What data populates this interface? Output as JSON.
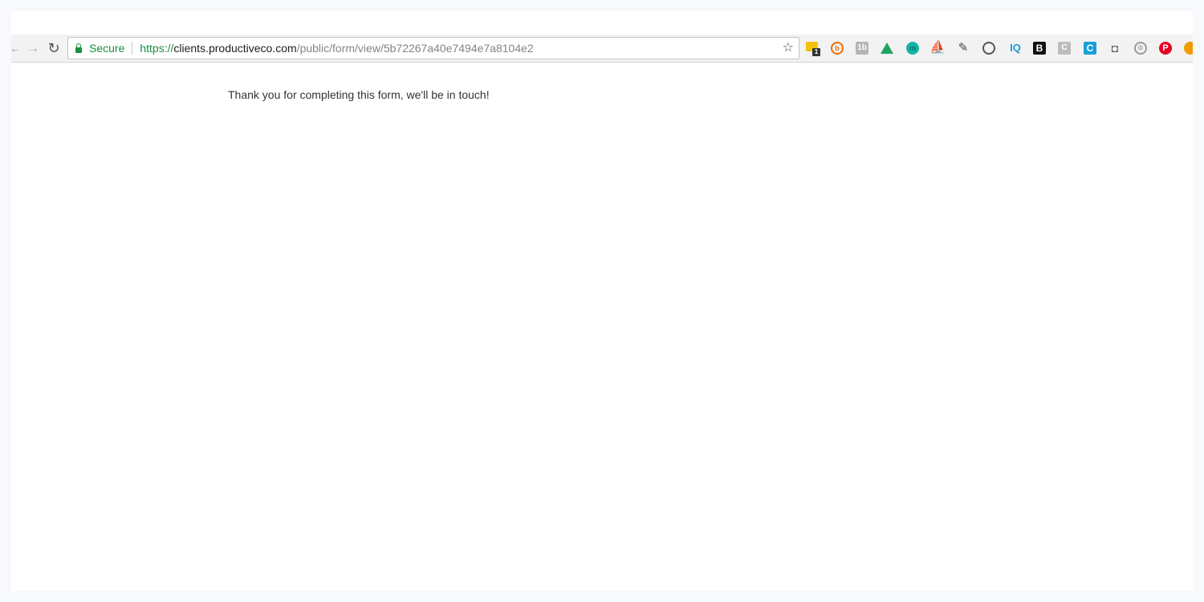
{
  "browser": {
    "nav": {
      "back_icon": "←",
      "forward_icon": "→",
      "reload_icon": "↻"
    },
    "omnibox": {
      "security_label": "Secure",
      "url_scheme": "https://",
      "url_host": "clients.productiveco.com",
      "url_path": "/public/form/view/5b72267a40e7494e7a8104e2"
    },
    "bookmark_icon": "☆",
    "extensions": [
      {
        "name": "notes-extension-icon",
        "label": "",
        "badge": "1"
      },
      {
        "name": "b-circle-extension-icon",
        "label": "b"
      },
      {
        "name": "1b-extension-icon",
        "label": "1b"
      },
      {
        "name": "google-drive-icon",
        "label": ""
      },
      {
        "name": "teal-circle-extension-icon",
        "label": "m"
      },
      {
        "name": "sail-extension-icon",
        "label": "⛵"
      },
      {
        "name": "eyedropper-icon",
        "label": "✎"
      },
      {
        "name": "circle-logo-extension-icon",
        "label": ""
      },
      {
        "name": "iq-extension-icon",
        "label": "IQ"
      },
      {
        "name": "b-square-extension-icon",
        "label": "B"
      },
      {
        "name": "c-gray-extension-icon",
        "label": "C"
      },
      {
        "name": "c-blue-extension-icon",
        "label": "C"
      },
      {
        "name": "camera-icon",
        "label": "◘"
      },
      {
        "name": "globe-extension-icon",
        "label": "⦶"
      },
      {
        "name": "pinterest-icon",
        "label": "P"
      },
      {
        "name": "orange-extension-icon",
        "label": ""
      }
    ]
  },
  "page": {
    "message": "Thank you for completing this form, we'll be in touch!"
  },
  "colors": {
    "secure_green": "#1e8e3e",
    "url_path_gray": "#80868b",
    "toolbar_bg": "#f2f2f2"
  }
}
